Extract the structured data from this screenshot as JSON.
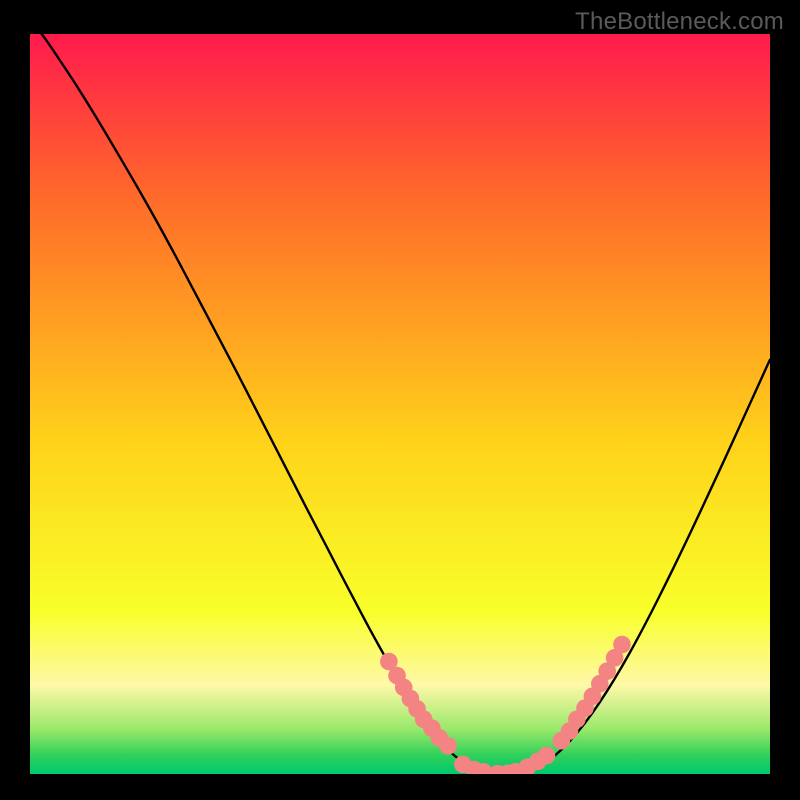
{
  "watermark": "TheBottleneck.com",
  "colors": {
    "grad_top": "#ff1a4d",
    "grad_upper": "#ff6a2a",
    "grad_mid": "#ffd21a",
    "grad_lower": "#f8ff2a",
    "grad_pale": "#fff8a8",
    "grad_green1": "#98e86a",
    "grad_green2": "#2fd05a",
    "grad_green3": "#00c86e",
    "curve": "#000000",
    "dot_fill": "#f48383",
    "dot_stroke": "#b85a5a",
    "background": "#000000"
  },
  "chart_data": {
    "type": "line",
    "title": "",
    "xlabel": "",
    "ylabel": "",
    "xlim": [
      0,
      100
    ],
    "ylim": [
      0,
      100
    ],
    "grid": false,
    "legend": false,
    "series_curve": {
      "name": "bottleneck-curve",
      "x": [
        0,
        2,
        4,
        6,
        8,
        10,
        12,
        14,
        16,
        18,
        20,
        22,
        24,
        26,
        28,
        30,
        32,
        34,
        36,
        38,
        40,
        42,
        44,
        46,
        48,
        50,
        52,
        54,
        56,
        58,
        60,
        62,
        64,
        66,
        68,
        70,
        72,
        74,
        76,
        78,
        80,
        82,
        84,
        86,
        88,
        90,
        92,
        94,
        96,
        98,
        100
      ],
      "y": [
        102,
        99.5,
        96.5,
        93.5,
        90.3,
        87,
        83.6,
        80.2,
        76.7,
        73.1,
        69.4,
        65.6,
        61.8,
        58,
        54.2,
        50.3,
        46.4,
        42.5,
        38.6,
        34.7,
        30.9,
        27,
        23.2,
        19.4,
        15.8,
        12.3,
        9,
        6.1,
        3.7,
        1.9,
        0.7,
        0.15,
        0,
        0.1,
        0.6,
        1.7,
        3.4,
        5.6,
        8.2,
        11.2,
        14.5,
        18.1,
        21.9,
        25.9,
        30,
        34.2,
        38.5,
        42.8,
        47.2,
        51.6,
        56
      ]
    },
    "points_left": {
      "name": "left-cluster-dots",
      "x": [
        48.5,
        49.6,
        50.5,
        51.4,
        52.3,
        53.2,
        54.3,
        55.3,
        56.5
      ],
      "y": [
        15.2,
        13.3,
        11.7,
        10.2,
        8.8,
        7.4,
        6.2,
        4.9,
        3.8
      ]
    },
    "points_bottom": {
      "name": "bottom-cluster-dots",
      "x": [
        58.5,
        60,
        61.3,
        63.2,
        64.6,
        65.6,
        67.2,
        68.6,
        69.8
      ],
      "y": [
        1.3,
        0.6,
        0.3,
        0.05,
        0.1,
        0.3,
        0.9,
        1.7,
        2.5
      ]
    },
    "points_right": {
      "name": "right-cluster-dots",
      "x": [
        71.8,
        72.9,
        73.9,
        75.0,
        76.0,
        77.0,
        78.0,
        79.0,
        80.0
      ],
      "y": [
        4.5,
        5.8,
        7.4,
        8.9,
        10.5,
        12.2,
        13.9,
        15.7,
        17.5
      ]
    }
  }
}
